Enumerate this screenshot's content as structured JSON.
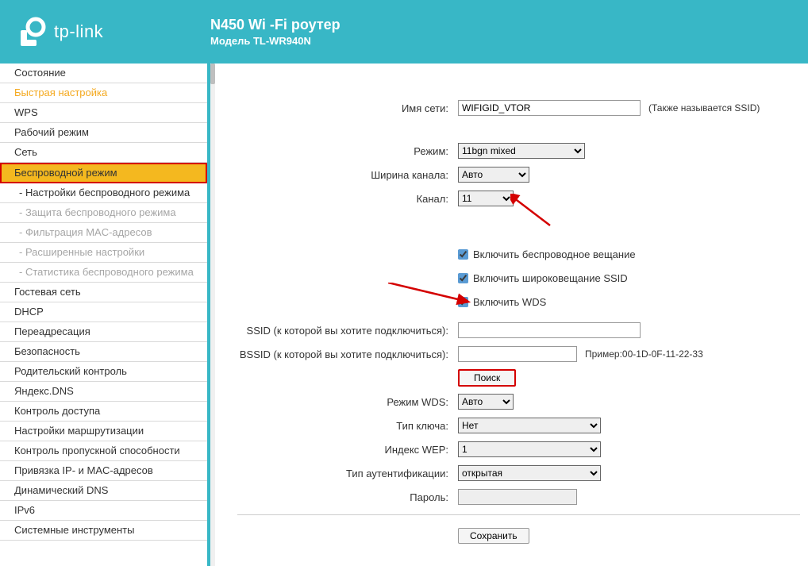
{
  "header": {
    "brand": "tp-link",
    "title": "N450 Wi -Fi роутер",
    "model": "Модель TL-WR940N"
  },
  "sidebar": {
    "items": [
      {
        "label": "Состояние",
        "type": "main"
      },
      {
        "label": "Быстрая настройка",
        "type": "quick"
      },
      {
        "label": "WPS",
        "type": "main"
      },
      {
        "label": "Рабочий режим",
        "type": "main"
      },
      {
        "label": "Сеть",
        "type": "main"
      },
      {
        "label": "Беспроводной режим",
        "type": "active"
      },
      {
        "label": "- Настройки беспроводного режима",
        "type": "sub-active"
      },
      {
        "label": "- Защита беспроводного режима",
        "type": "sub"
      },
      {
        "label": "- Фильтрация MAC-адресов",
        "type": "sub"
      },
      {
        "label": "- Расширенные настройки",
        "type": "sub"
      },
      {
        "label": "- Статистика беспроводного режима",
        "type": "sub"
      },
      {
        "label": "Гостевая сеть",
        "type": "main"
      },
      {
        "label": "DHCP",
        "type": "main"
      },
      {
        "label": "Переадресация",
        "type": "main"
      },
      {
        "label": "Безопасность",
        "type": "main"
      },
      {
        "label": "Родительский контроль",
        "type": "main"
      },
      {
        "label": "Яндекс.DNS",
        "type": "main"
      },
      {
        "label": "Контроль доступа",
        "type": "main"
      },
      {
        "label": "Настройки маршрутизации",
        "type": "main"
      },
      {
        "label": "Контроль пропускной способности",
        "type": "main"
      },
      {
        "label": "Привязка IP- и MAC-адресов",
        "type": "main"
      },
      {
        "label": "Динамический DNS",
        "type": "main"
      },
      {
        "label": "IPv6",
        "type": "main"
      },
      {
        "label": "Системные инструменты",
        "type": "main"
      }
    ]
  },
  "form": {
    "ssid_label": "Имя сети:",
    "ssid_value": "WIFIGID_VTOR",
    "ssid_hint": "(Также называется SSID)",
    "mode_label": "Режим:",
    "mode_value": "11bgn mixed",
    "width_label": "Ширина канала:",
    "width_value": "Авто",
    "channel_label": "Канал:",
    "channel_value": "11",
    "cb_broadcast": "Включить беспроводное вещание",
    "cb_ssid": "Включить широковещание SSID",
    "cb_wds": "Включить WDS",
    "wds_ssid_label": "SSID (к которой вы хотите подключиться):",
    "wds_bssid_label": "BSSID (к которой вы хотите подключиться):",
    "bssid_hint": "Пример:00-1D-0F-11-22-33",
    "search_btn": "Поиск",
    "wds_mode_label": "Режим WDS:",
    "wds_mode_value": "Авто",
    "key_label": "Тип ключа:",
    "key_value": "Нет",
    "wep_label": "Индекс WEP:",
    "wep_value": "1",
    "auth_label": "Тип аутентификации:",
    "auth_value": "открытая",
    "pass_label": "Пароль:",
    "save_btn": "Сохранить"
  }
}
